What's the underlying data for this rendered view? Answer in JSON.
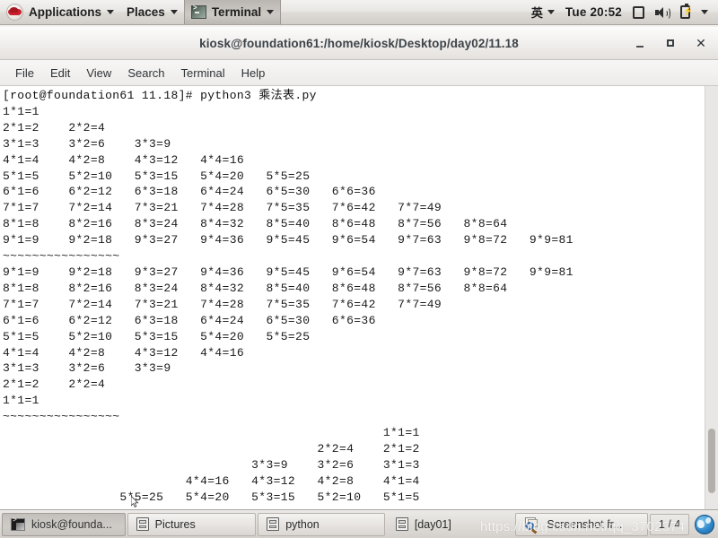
{
  "top_panel": {
    "logo_icon": "redhat-logo-icon",
    "applications_label": "Applications",
    "places_label": "Places",
    "active_app_label": "Terminal",
    "active_app_icon": "terminal-icon",
    "ime_label": "英",
    "clock": "Tue 20:52",
    "display_icon": "display-icon",
    "volume_icon": "volume-icon",
    "battery_icon": "battery-icon",
    "system_menu_icon": "chevron-down-icon"
  },
  "window": {
    "title": "kiosk@foundation61:/home/kiosk/Desktop/day02/11.18",
    "minimize_label": "",
    "maximize_label": "",
    "close_label": "✕",
    "menu": [
      "File",
      "Edit",
      "View",
      "Search",
      "Terminal",
      "Help"
    ]
  },
  "terminal": {
    "prompt": "[root@foundation61 11.18]# ",
    "command": "python3 乘法表.py",
    "lines": [
      "1*1=1",
      "2*1=2    2*2=4",
      "3*1=3    3*2=6    3*3=9",
      "4*1=4    4*2=8    4*3=12   4*4=16",
      "5*1=5    5*2=10   5*3=15   5*4=20   5*5=25",
      "6*1=6    6*2=12   6*3=18   6*4=24   6*5=30   6*6=36",
      "7*1=7    7*2=14   7*3=21   7*4=28   7*5=35   7*6=42   7*7=49",
      "8*1=8    8*2=16   8*3=24   8*4=32   8*5=40   8*6=48   8*7=56   8*8=64",
      "9*1=9    9*2=18   9*3=27   9*4=36   9*5=45   9*6=54   9*7=63   9*8=72   9*9=81",
      "~~~~~~~~~~~~~~~~",
      "9*1=9    9*2=18   9*3=27   9*4=36   9*5=45   9*6=54   9*7=63   9*8=72   9*9=81",
      "8*1=8    8*2=16   8*3=24   8*4=32   8*5=40   8*6=48   8*7=56   8*8=64",
      "7*1=7    7*2=14   7*3=21   7*4=28   7*5=35   7*6=42   7*7=49",
      "6*1=6    6*2=12   6*3=18   6*4=24   6*5=30   6*6=36",
      "5*1=5    5*2=10   5*3=15   5*4=20   5*5=25",
      "4*1=4    4*2=8    4*3=12   4*4=16",
      "3*1=3    3*2=6    3*3=9",
      "2*1=2    2*2=4",
      "1*1=1",
      "~~~~~~~~~~~~~~~~",
      "                                                    1*1=1",
      "                                           2*2=4    2*1=2",
      "                                  3*3=9    3*2=6    3*1=3",
      "                         4*4=16   4*3=12   4*2=8    4*1=4",
      "                5*5=25   5*4=20   5*3=15   5*2=10   5*1=5"
    ],
    "scrollbar": "vertical-scrollbar",
    "cursor_icon": "mouse-pointer-icon"
  },
  "taskbar": {
    "tasks": [
      {
        "label": "kiosk@founda...",
        "icon": "terminal-icon",
        "active": true
      },
      {
        "label": "Pictures",
        "icon": "file-drawer-icon",
        "active": false
      },
      {
        "label": "python",
        "icon": "file-drawer-icon",
        "active": false
      },
      {
        "label": "[day01]",
        "icon": "file-drawer-icon",
        "active": false
      },
      {
        "label": "Screenshot fr...",
        "icon": "screenshot-icon",
        "active": false
      }
    ],
    "page_indicator": "1 / 4",
    "workspace_switcher_icon": "workspace-globe-icon"
  },
  "watermark": {
    "text": "https://blog.csdn.net/qq_3702374"
  },
  "colors": {
    "panel_bg": "#e4e1de",
    "terminal_bg": "#ffffff",
    "terminal_fg": "#1a1a1a",
    "title_fg": "#3d4349",
    "accent": "#c9202b"
  }
}
